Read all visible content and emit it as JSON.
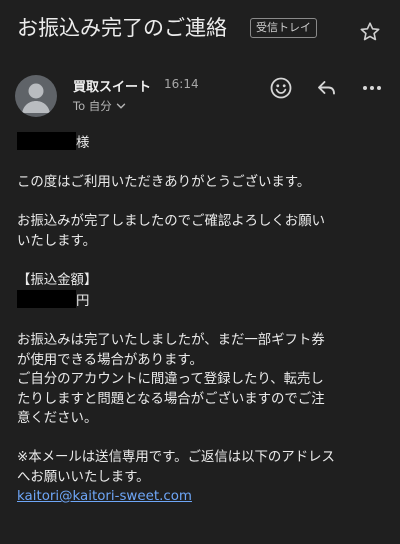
{
  "header": {
    "subject": "お振込み完了のご連絡",
    "label": "受信トレイ"
  },
  "sender": {
    "name": "買取スイート",
    "time": "16:14",
    "to": "To 自分"
  },
  "message": {
    "salutation_suffix": "様",
    "p1": "この度はご利用いただきありがとうございます。",
    "p2": "お振込みが完了しましたのでご確認よろしくお願い\nいたします。",
    "amount_heading": "【振込金額】",
    "amount_suffix": "円",
    "p3": "お振込みは完了いたしましたが、まだ一部ギフト券\nが使用できる場合があります。\nご自分のアカウントに間違って登録したり、転売し\nたりしますと問題となる場合がございますのでご注\n意ください。",
    "p4": "※本メールは送信専用です。ご返信は以下のアドレス\nへお願いいたします。",
    "contact_email": "kaitori@kaitori-sweet.com"
  },
  "icons": {
    "star": "star-outline-icon",
    "emoji": "emoji-reaction-icon",
    "reply": "reply-icon",
    "more": "more-options-icon",
    "avatar": "default-avatar-icon",
    "chevron": "chevron-down-icon"
  },
  "colors": {
    "background": "#1f1f1f",
    "link": "#6ea6f7"
  }
}
